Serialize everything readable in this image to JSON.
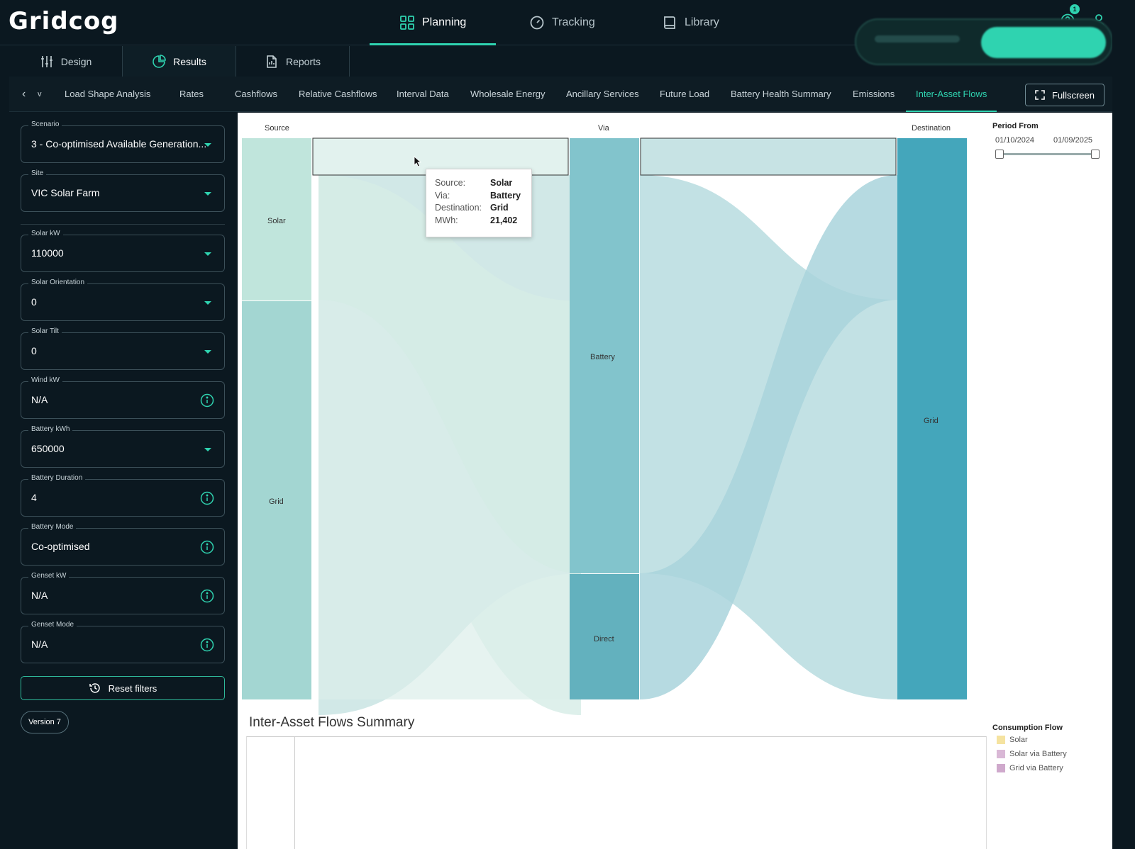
{
  "app": {
    "logo": "Gridcog",
    "nav": [
      {
        "label": "Planning"
      },
      {
        "label": "Tracking"
      },
      {
        "label": "Library"
      }
    ],
    "notification_count": "1"
  },
  "section_tabs": [
    {
      "label": "Design"
    },
    {
      "label": "Results"
    },
    {
      "label": "Reports"
    }
  ],
  "subtabs": {
    "back": "‹",
    "partial": "v",
    "items": [
      "Load Shape Analysis",
      "Rates",
      "Cashflows",
      "Relative Cashflows",
      "Interval Data",
      "Wholesale Energy",
      "Ancillary Services",
      "Future Load",
      "Battery Health Summary",
      "Emissions",
      "Inter-Asset Flows"
    ],
    "fullscreen": "Fullscreen"
  },
  "sidebar": {
    "fields": [
      {
        "label": "Scenario",
        "value": "3 - Co-optimised Available Generation...",
        "type": "select"
      },
      {
        "label": "Site",
        "value": "VIC Solar Farm",
        "type": "select"
      },
      {
        "label": "Solar kW",
        "value": "110000",
        "type": "select"
      },
      {
        "label": "Solar Orientation",
        "value": "0",
        "type": "select"
      },
      {
        "label": "Solar Tilt",
        "value": "0",
        "type": "select"
      },
      {
        "label": "Wind kW",
        "value": "N/A",
        "type": "info"
      },
      {
        "label": "Battery kWh",
        "value": "650000",
        "type": "select"
      },
      {
        "label": "Battery Duration",
        "value": "4",
        "type": "info"
      },
      {
        "label": "Battery Mode",
        "value": "Co-optimised",
        "type": "info"
      },
      {
        "label": "Genset kW",
        "value": "N/A",
        "type": "info"
      },
      {
        "label": "Genset Mode",
        "value": "N/A",
        "type": "info"
      }
    ],
    "reset_label": "Reset filters",
    "version": "Version 7"
  },
  "chart": {
    "col_source": "Source",
    "col_via": "Via",
    "col_destination": "Destination",
    "nodes": {
      "solar": "Solar",
      "grid_src": "Grid",
      "battery": "Battery",
      "direct": "Direct",
      "grid_dst": "Grid"
    },
    "tooltip": {
      "source_k": "Source:",
      "source_v": "Solar",
      "via_k": "Via:",
      "via_v": "Battery",
      "dest_k": "Destination:",
      "dest_v": "Grid",
      "mwh_k": "MWh:",
      "mwh_v": "21,402"
    },
    "period": {
      "title": "Period From",
      "from": "01/10/2024",
      "to": "01/09/2025"
    },
    "summary_title": "Inter-Asset Flows Summary",
    "legend": {
      "title": "Consumption Flow",
      "items": [
        {
          "label": "Solar",
          "color": "#f5e3a0"
        },
        {
          "label": "Solar via Battery",
          "color": "#d9b8d6"
        },
        {
          "label": "Grid via Battery",
          "color": "#cfa9cc"
        }
      ]
    }
  },
  "colors": {
    "accent": "#2fd3b0",
    "bg": "#0b1820"
  }
}
